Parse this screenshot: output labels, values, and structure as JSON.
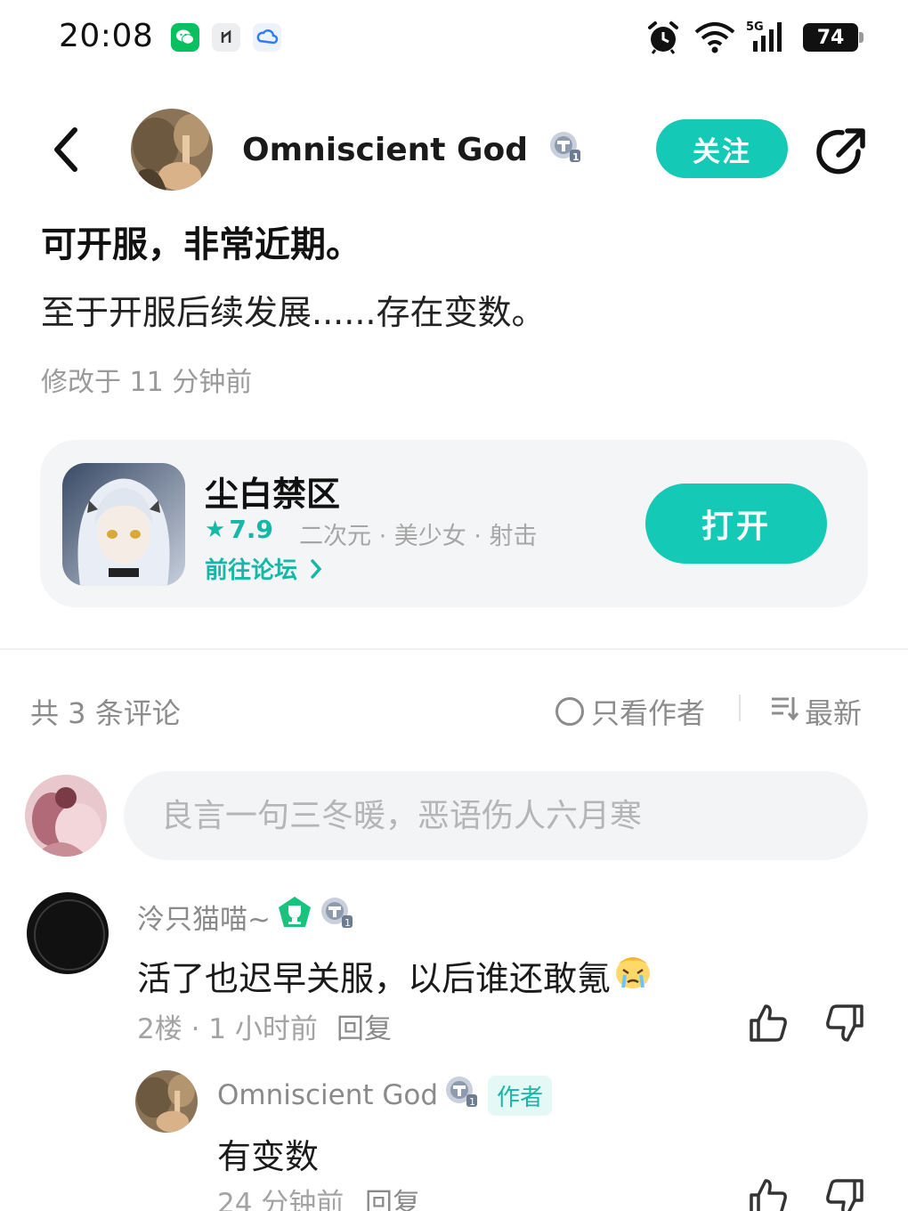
{
  "status_bar": {
    "time": "20:08",
    "network": "5G",
    "battery": "74",
    "notification_icons": [
      "wechat-icon",
      "app-icon",
      "cloud-icon"
    ]
  },
  "header": {
    "author_name": "Omniscient God",
    "follow_label": "关注"
  },
  "post": {
    "title": "可开服，非常近期。",
    "body": "至于开服后续发展......存在变数。",
    "meta": "修改于 11 分钟前"
  },
  "game_card": {
    "name": "尘白禁区",
    "rating": "7.9",
    "tags": "二次元 · 美少女 · 射击",
    "forum_link": "前往论坛",
    "open_label": "打开"
  },
  "comments_header": {
    "count": "共 3 条评论",
    "only_author": "只看作者",
    "sort": "最新"
  },
  "comment_input": {
    "placeholder": "良言一句三冬暖，恶语伤人六月寒"
  },
  "comments": [
    {
      "user": "泠只猫喵~",
      "text": "活了也迟早关服，以后谁还敢氪",
      "floor_time": "2楼 · 1 小时前",
      "reply_label": "回复",
      "replies": [
        {
          "user": "Omniscient God",
          "author_tag": "作者",
          "text": "有变数",
          "time": "24 分钟前",
          "reply_label": "回复"
        }
      ]
    }
  ],
  "colors": {
    "accent": "#14c9b5",
    "accent_text": "#14b8a6",
    "muted": "#8c8c8c"
  }
}
